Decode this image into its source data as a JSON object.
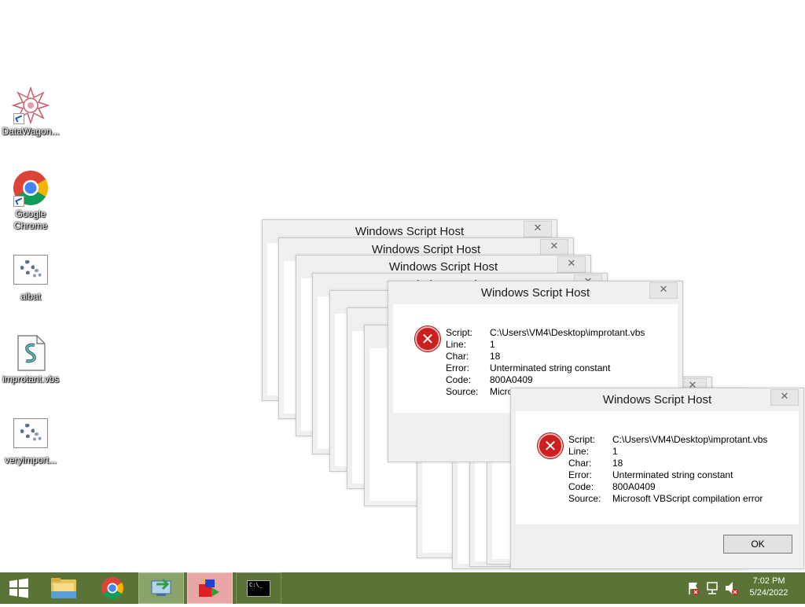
{
  "desktop": {
    "icons": [
      {
        "label": "DataWagon...",
        "icon": "datawagon-icon"
      },
      {
        "label": "Google Chrome",
        "icon": "chrome-icon"
      },
      {
        "label": "albat",
        "icon": "vbs-script-gear-icon"
      },
      {
        "label": "improtant.vbs",
        "icon": "vbs-file-icon"
      },
      {
        "label": "veryimport...",
        "icon": "vbs-script-gear-icon"
      }
    ]
  },
  "dialog": {
    "title": "Windows Script Host",
    "close_glyph": "✕",
    "fields": [
      {
        "key": "Script:",
        "value": "C:\\Users\\VM4\\Desktop\\improtant.vbs"
      },
      {
        "key": "Line:",
        "value": "1"
      },
      {
        "key": "Char:",
        "value": "18"
      },
      {
        "key": "Error:",
        "value": "Unterminated string constant"
      },
      {
        "key": "Code:",
        "value": "800A0409"
      },
      {
        "key": "Source:",
        "value": "Microsoft VBScript compilation error"
      }
    ],
    "partial_source": "Micro",
    "ok_label": "OK"
  },
  "taskbar": {
    "items": [
      "start-button",
      "file-explorer",
      "google-chrome",
      "network-app",
      "setup-app",
      "command-prompt"
    ],
    "tray_icons": [
      "flag-icon",
      "network-icon",
      "volume-muted-icon"
    ],
    "time": "7:02 PM",
    "date": "5/24/2022",
    "cmd_glyph": "C:\\_"
  }
}
